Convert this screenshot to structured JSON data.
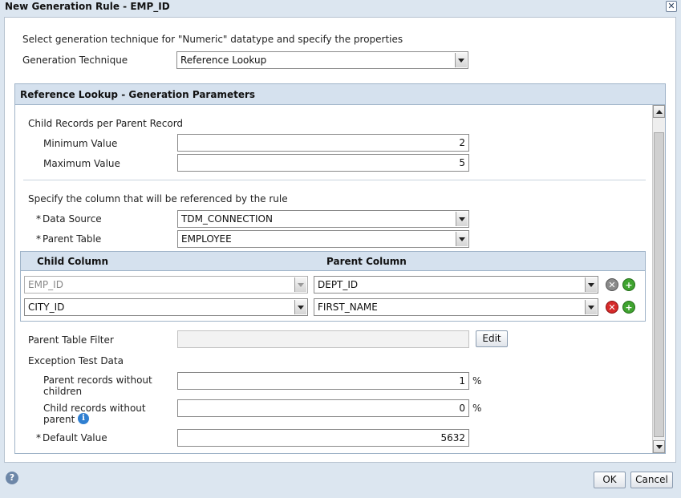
{
  "window": {
    "title": "New Generation Rule - EMP_ID",
    "close_glyph": "✕"
  },
  "intro_text": "Select generation technique for \"Numeric\" datatype and specify the properties",
  "technique": {
    "label": "Generation Technique",
    "value": "Reference Lookup"
  },
  "params_section": {
    "title": "Reference Lookup - Generation Parameters",
    "child_records_label": "Child Records per Parent Record",
    "min": {
      "label": "Minimum Value",
      "value": "2"
    },
    "max": {
      "label": "Maximum Value",
      "value": "5"
    },
    "reference_text": "Specify the column that will be referenced by the rule",
    "data_source": {
      "required": "*",
      "label": "Data Source",
      "value": "TDM_CONNECTION"
    },
    "parent_table": {
      "required": "*",
      "label": "Parent Table",
      "value": "EMPLOYEE"
    },
    "grid": {
      "headers": {
        "child": "Child Column",
        "parent": "Parent Column"
      },
      "rows": [
        {
          "child": "EMP_ID",
          "parent": "DEPT_ID",
          "child_disabled": true
        },
        {
          "child": "CITY_ID",
          "parent": "FIRST_NAME",
          "child_disabled": false
        }
      ],
      "delete_glyph": "✕",
      "add_glyph": "+"
    },
    "filter": {
      "label": "Parent Table Filter",
      "value": "",
      "edit_label": "Edit"
    },
    "exception_label": "Exception Test Data",
    "parents_without_children": {
      "label_line1": "Parent records without",
      "label_line2": "children",
      "value": "1",
      "unit": "%"
    },
    "children_without_parent": {
      "label_line1": "Child records without",
      "label_line2": "parent",
      "value": "0",
      "unit": "%",
      "info_glyph": "i"
    },
    "default_value": {
      "required": "*",
      "label": "Default Value",
      "value": "5632"
    }
  },
  "footer": {
    "help_glyph": "?",
    "ok_label": "OK",
    "cancel_label": "Cancel"
  }
}
